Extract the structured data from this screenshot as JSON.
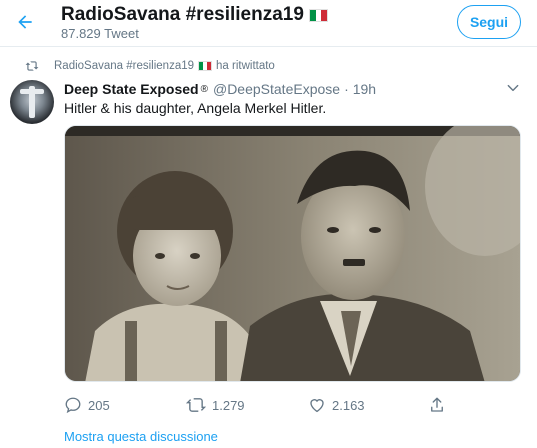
{
  "header": {
    "title": "RadioSavana #resilienza19",
    "tweet_count": "87.829 Tweet",
    "follow_label": "Segui"
  },
  "retweet": {
    "user": "RadioSavana #resilienza19",
    "action": "ha ritwittato"
  },
  "tweet": {
    "name": "Deep State Exposed",
    "badge": "®",
    "handle": "@DeepStateExpose",
    "separator": "·",
    "time": "19h",
    "text": "Hitler & his daughter, Angela Merkel Hitler."
  },
  "actions": {
    "replies": "205",
    "retweets": "1.279",
    "likes": "2.163"
  },
  "footer": {
    "discussion_link": "Mostra questa discussione"
  },
  "colors": {
    "accent": "#1da1f2",
    "secondary_text": "#657786",
    "flag_green": "#009246",
    "flag_white": "#ffffff",
    "flag_red": "#ce2b37"
  },
  "icons": [
    "back-arrow-icon",
    "italian-flag-icon",
    "retweet-icon",
    "chevron-down-icon",
    "reply-icon",
    "like-icon",
    "share-icon"
  ]
}
